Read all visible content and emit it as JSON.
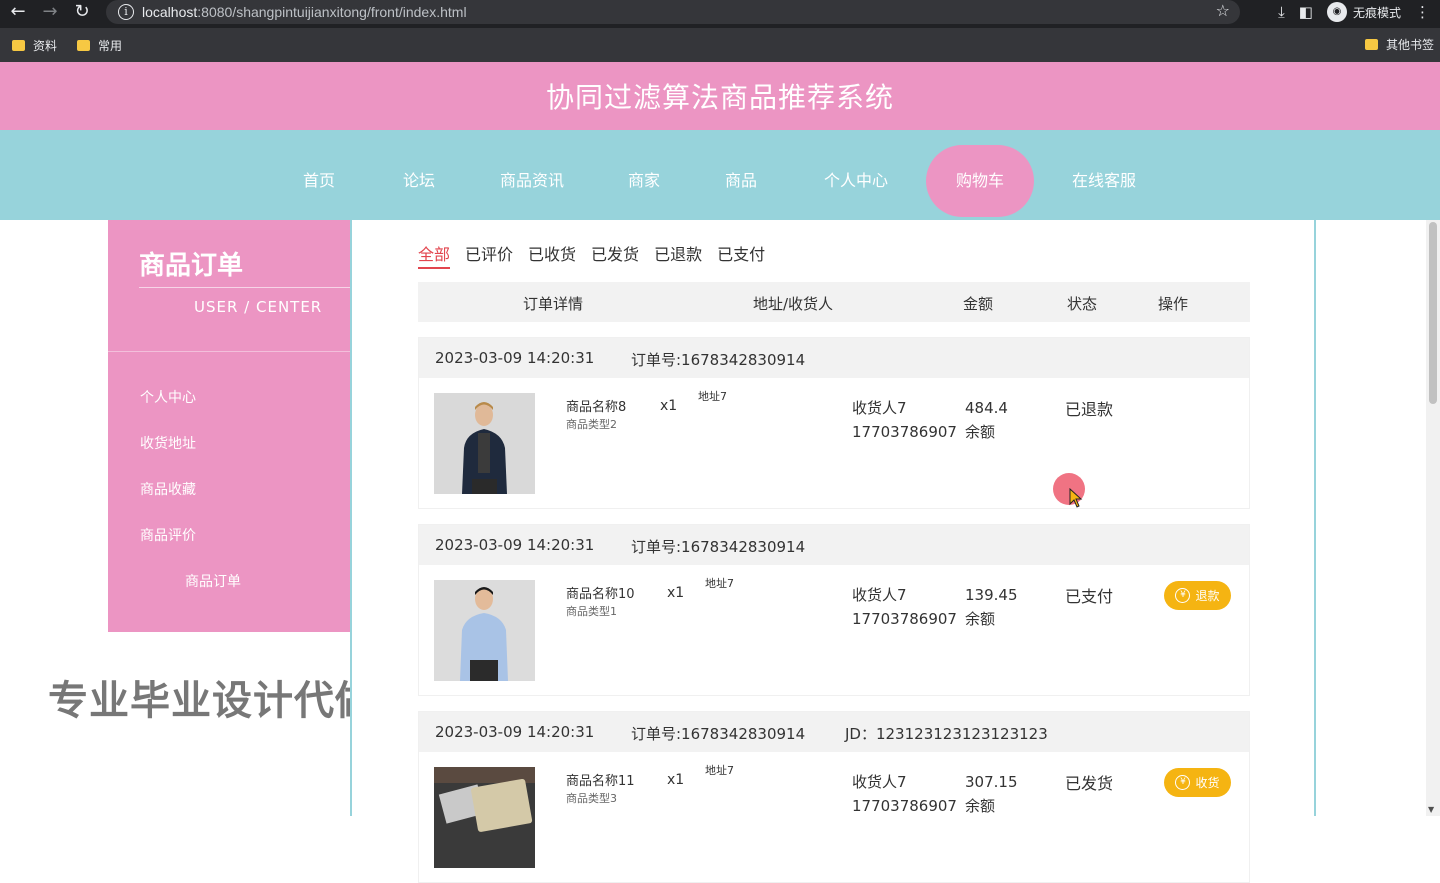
{
  "browser": {
    "url_host": "localhost",
    "url_path": ":8080/shangpintuijianxitong/front/index.html",
    "profile_label": "无痕模式",
    "bookmarks": [
      "资料",
      "常用"
    ],
    "other_bookmarks": "其他书签"
  },
  "site": {
    "title": "协同过滤算法商品推荐系统"
  },
  "nav": {
    "items": [
      "首页",
      "论坛",
      "商品资讯",
      "商家",
      "商品",
      "个人中心",
      "购物车",
      "在线客服"
    ],
    "active": "购物车"
  },
  "sidebar": {
    "title": "商品订单",
    "subtitle": "USER / CENTER",
    "items": [
      "个人中心",
      "收货地址",
      "商品收藏",
      "商品评价",
      "商品订单"
    ],
    "active": "商品订单"
  },
  "watermark": "专业毕业设计代做",
  "tabs": {
    "items": [
      "全部",
      "已评价",
      "已收货",
      "已发货",
      "已退款",
      "已支付"
    ],
    "active": "全部"
  },
  "table_headers": [
    "订单详情",
    "地址/收货人",
    "金额",
    "状态",
    "操作"
  ],
  "orders": [
    {
      "date": "2023-03-09 14:20:31",
      "order_no": "订单号:1678342830914",
      "jd": "",
      "product_name": "商品名称8",
      "product_type": "商品类型2",
      "qty": "x1",
      "address": "地址7",
      "receiver": "收货人7",
      "phone": "17703786907",
      "amount": "484.4",
      "pay_method": "余额",
      "status": "已退款",
      "action": ""
    },
    {
      "date": "2023-03-09 14:20:31",
      "order_no": "订单号:1678342830914",
      "jd": "",
      "product_name": "商品名称10",
      "product_type": "商品类型1",
      "qty": "x1",
      "address": "地址7",
      "receiver": "收货人7",
      "phone": "17703786907",
      "amount": "139.45",
      "pay_method": "余额",
      "status": "已支付",
      "action": "退款"
    },
    {
      "date": "2023-03-09 14:20:31",
      "order_no": "订单号:1678342830914",
      "jd": "JD：123123123123123123",
      "product_name": "商品名称11",
      "product_type": "商品类型3",
      "qty": "x1",
      "address": "地址7",
      "receiver": "收货人7",
      "phone": "17703786907",
      "amount": "307.15",
      "pay_method": "余额",
      "status": "已发货",
      "action": "收货"
    }
  ],
  "colors": {
    "header_pink": "#ec95c3",
    "nav_teal": "#97d3db",
    "tab_active_red": "#e2454e",
    "button_yellow": "#f5b412"
  }
}
